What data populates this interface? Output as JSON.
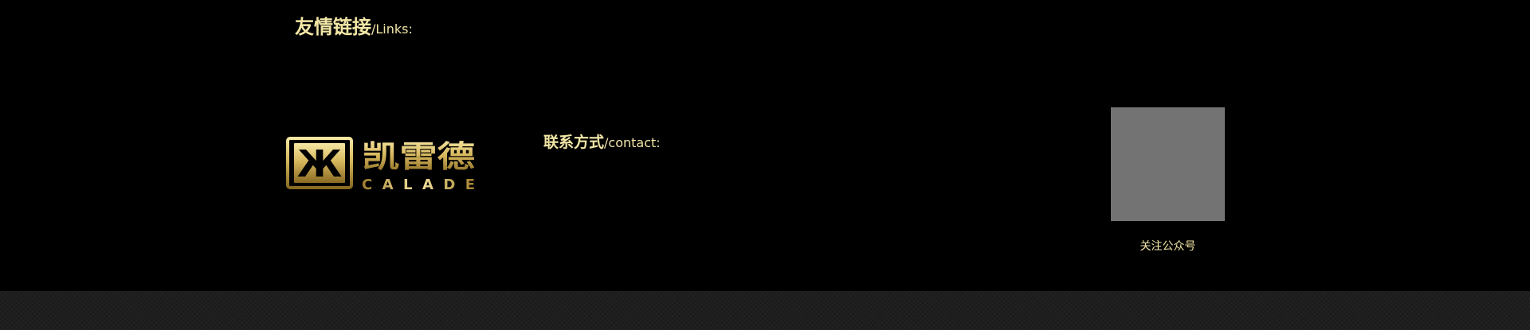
{
  "links": {
    "title_zh": "友情链接",
    "title_en": "/Links:"
  },
  "logo": {
    "mark_glyph": "Ж",
    "brand_zh": "凯雷德",
    "brand_en": "CALADE",
    "gold_light": "#f7e7a3",
    "gold_dark": "#8a6a22"
  },
  "contact": {
    "title_zh": "联系方式",
    "title_en": "/contact:"
  },
  "qr": {
    "caption": "关注公众号",
    "placeholder_color": "#737373"
  },
  "colors": {
    "background": "#000000",
    "accent_text": "#f2e6a6",
    "bottom_band": "#1b1b1b"
  }
}
